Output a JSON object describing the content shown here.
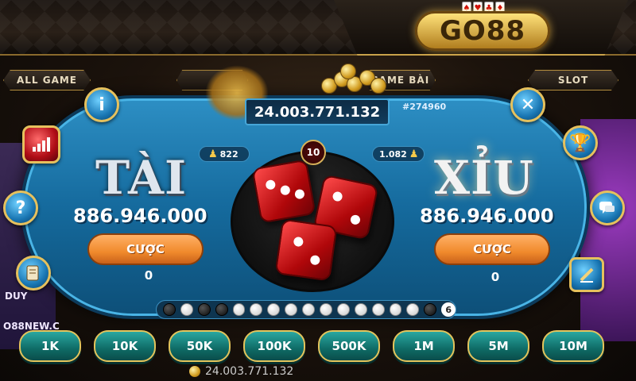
{
  "header": {
    "logo_text": "GO88",
    "tabs": [
      "ALL GAME",
      "GAME BÀI",
      "SLOT"
    ]
  },
  "background": {
    "left_texts": [
      "DUY",
      "O88NEW.C"
    ]
  },
  "table": {
    "balance": "24.003.771.132",
    "session_id": "#274960",
    "timer": "10",
    "tai": {
      "title": "TÀI",
      "players": "822",
      "pot": "886.946.000",
      "bet_label": "CƯỢC",
      "bet_value": "0"
    },
    "xiu": {
      "title": "XỈU",
      "players": "1.082",
      "pot": "886.946.000",
      "bet_label": "CƯỢC",
      "bet_value": "0"
    },
    "dice": [
      3,
      2,
      2
    ],
    "history": {
      "results": [
        "black",
        "white",
        "black",
        "black",
        "white",
        "white",
        "white",
        "white",
        "white",
        "white",
        "white",
        "white",
        "white",
        "white",
        "white",
        "white",
        "black"
      ],
      "count": "6"
    }
  },
  "chips": [
    "1K",
    "10K",
    "50K",
    "100K",
    "500K",
    "1M",
    "5M",
    "10M"
  ],
  "footer": {
    "balance": "24.003.771.132"
  },
  "icons": {
    "info": "info-icon",
    "close": "close-icon",
    "stats": "chart-icon",
    "trophy": "trophy-icon",
    "help": "question-icon",
    "chat": "chat-icon",
    "history": "scroll-icon",
    "quick_bet": "pencil-icon"
  }
}
